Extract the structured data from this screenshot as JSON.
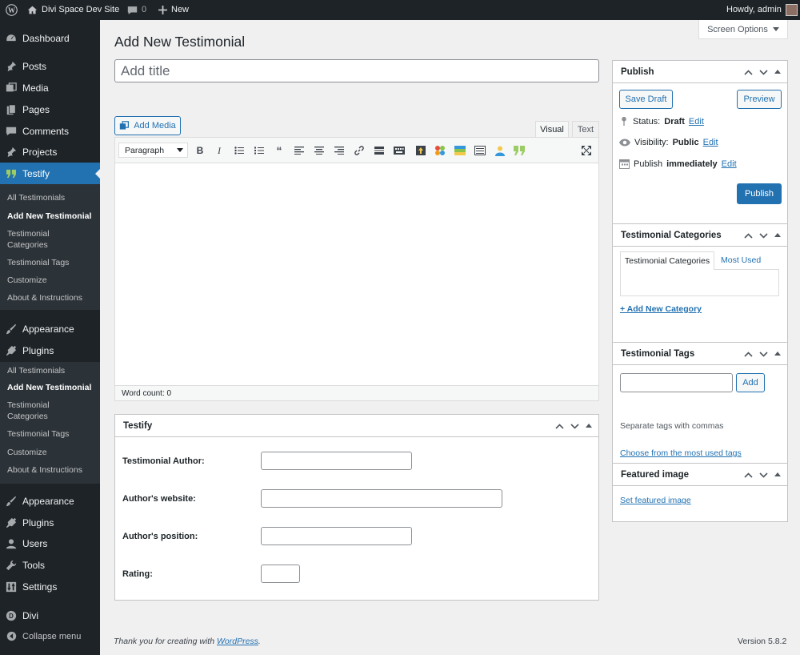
{
  "admin_bar": {
    "site_name": "Divi Space Dev Site",
    "comments_count": "0",
    "new_label": "New",
    "howdy": "Howdy, admin"
  },
  "sidebar": {
    "items": [
      {
        "label": "Dashboard",
        "icon": "dashboard-icon"
      },
      {
        "label": "Posts",
        "icon": "pin-icon"
      },
      {
        "label": "Media",
        "icon": "media-icon"
      },
      {
        "label": "Pages",
        "icon": "pages-icon"
      },
      {
        "label": "Comments",
        "icon": "comments-icon"
      },
      {
        "label": "Projects",
        "icon": "pin-icon"
      },
      {
        "label": "Testify",
        "icon": "quote-icon"
      },
      {
        "label": "Appearance",
        "icon": "brush-icon"
      },
      {
        "label": "Plugins",
        "icon": "plug-icon"
      },
      {
        "label": "Appearance",
        "icon": "brush-icon"
      },
      {
        "label": "Plugins",
        "icon": "plug-icon"
      },
      {
        "label": "Users",
        "icon": "user-icon"
      },
      {
        "label": "Tools",
        "icon": "wrench-icon"
      },
      {
        "label": "Settings",
        "icon": "settings-icon"
      },
      {
        "label": "Divi",
        "icon": "divi-icon"
      },
      {
        "label": "Collapse menu",
        "icon": "collapse-icon"
      }
    ],
    "submenu1": [
      "All Testimonials",
      "Add New Testimonial",
      "Testimonial Categories",
      "Testimonial Tags",
      "Customize",
      "About & Instructions"
    ],
    "submenu2": [
      "All Testimonials",
      "Add New Testimonial",
      "Testimonial Categories",
      "Testimonial Tags",
      "Customize",
      "About & Instructions"
    ]
  },
  "page": {
    "title": "Add New Testimonial",
    "screen_options": "Screen Options",
    "title_placeholder": "Add title"
  },
  "editor": {
    "add_media": "Add Media",
    "tab_visual": "Visual",
    "tab_text": "Text",
    "format_select": "Paragraph",
    "word_count": "Word count: 0"
  },
  "testify_box": {
    "title": "Testify",
    "author_label": "Testimonial Author:",
    "website_label": "Author's website:",
    "position_label": "Author's position:",
    "rating_label": "Rating:"
  },
  "publish": {
    "title": "Publish",
    "save_draft": "Save Draft",
    "preview": "Preview",
    "status_label": "Status:",
    "status_value": "Draft",
    "visibility_label": "Visibility:",
    "visibility_value": "Public",
    "publish_label": "Publish",
    "publish_value": "immediately",
    "edit": "Edit",
    "publish_button": "Publish"
  },
  "categories": {
    "title": "Testimonial Categories",
    "tab_all": "Testimonial Categories",
    "tab_most_used": "Most Used",
    "add_new": "+ Add New Category"
  },
  "tags": {
    "title": "Testimonial Tags",
    "add_button": "Add",
    "hint": "Separate tags with commas",
    "choose_link": "Choose from the most used tags"
  },
  "featured": {
    "title": "Featured image",
    "set_link": "Set featured image"
  },
  "footer": {
    "thanks_prefix": "Thank you for creating with ",
    "wp_link": "WordPress",
    "thanks_suffix": ".",
    "version": "Version 5.8.2"
  }
}
